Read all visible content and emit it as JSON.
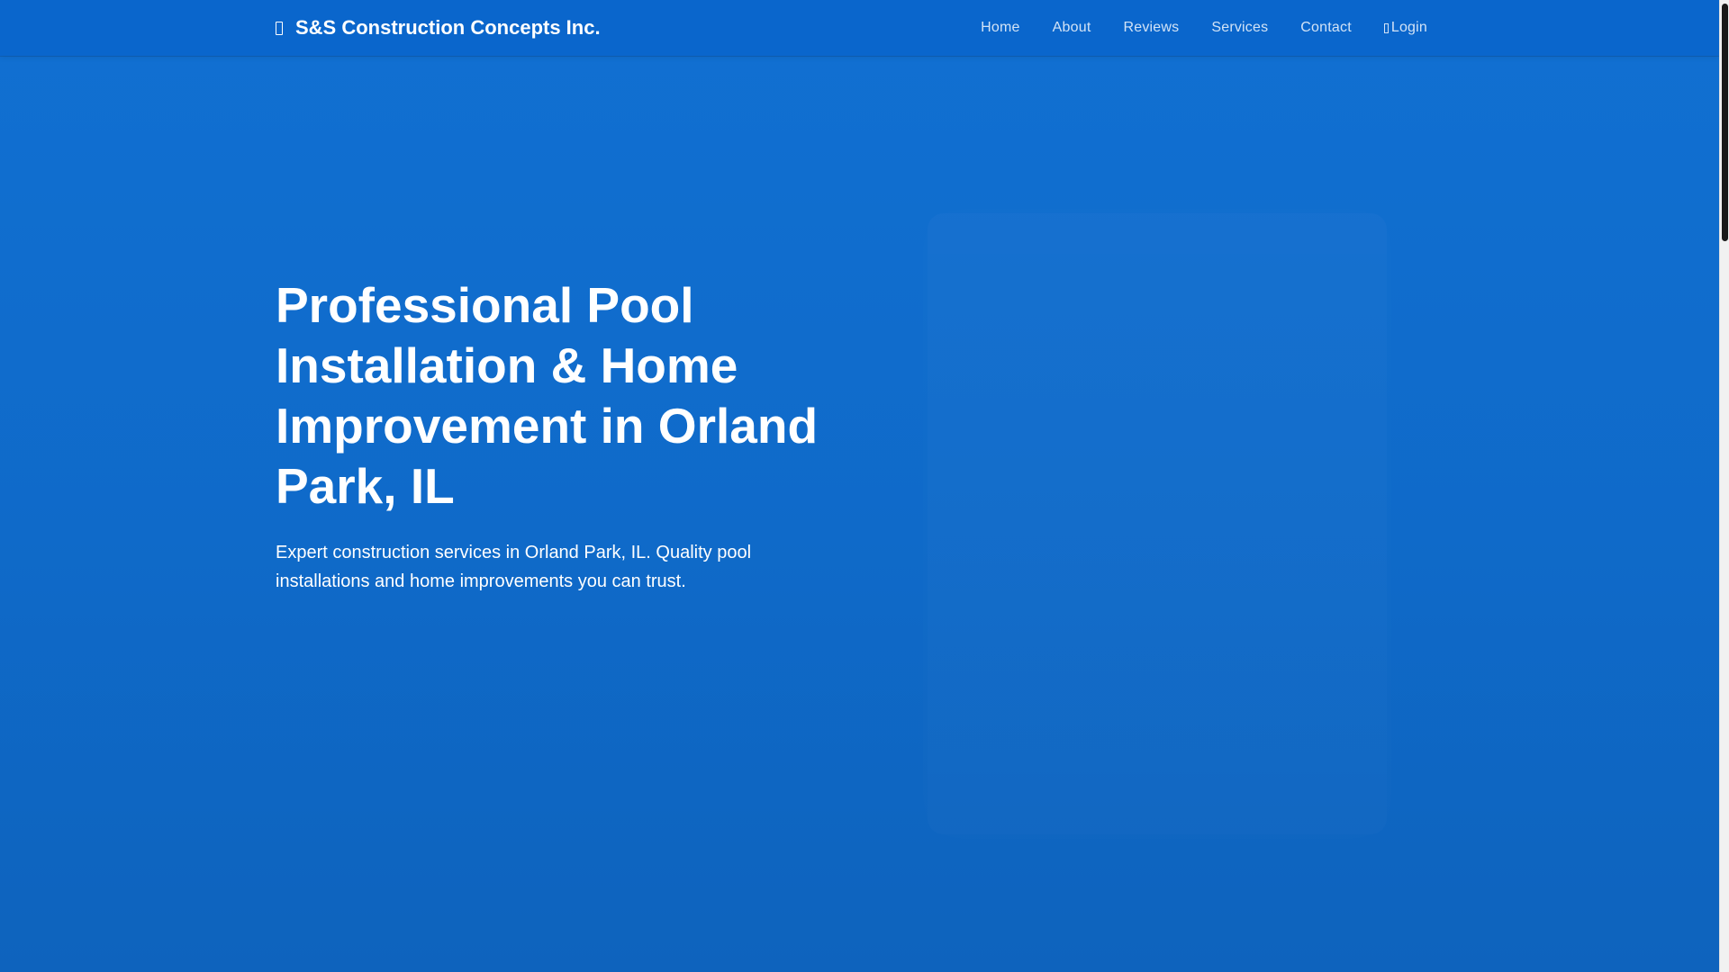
{
  "navbar": {
    "brand": {
      "icon": "building-icon",
      "name": "S&S Construction Concepts Inc."
    },
    "items": [
      {
        "label": "Home"
      },
      {
        "label": "About"
      },
      {
        "label": "Reviews"
      },
      {
        "label": "Services"
      },
      {
        "label": "Contact"
      },
      {
        "label": "Login",
        "icon": "login-icon"
      }
    ]
  },
  "hero": {
    "title": "Professional Pool Installation & Home Improvement in Orland Park, IL",
    "subtitle": "Expert construction services in Orland Park, IL. Quality pool installations and home improvements you can trust."
  },
  "colors": {
    "navbar_bg": "#0a66cc",
    "hero_bg": "#1170d2",
    "text": "#ffffff",
    "scroll_thumb": "#1a1a1a"
  }
}
